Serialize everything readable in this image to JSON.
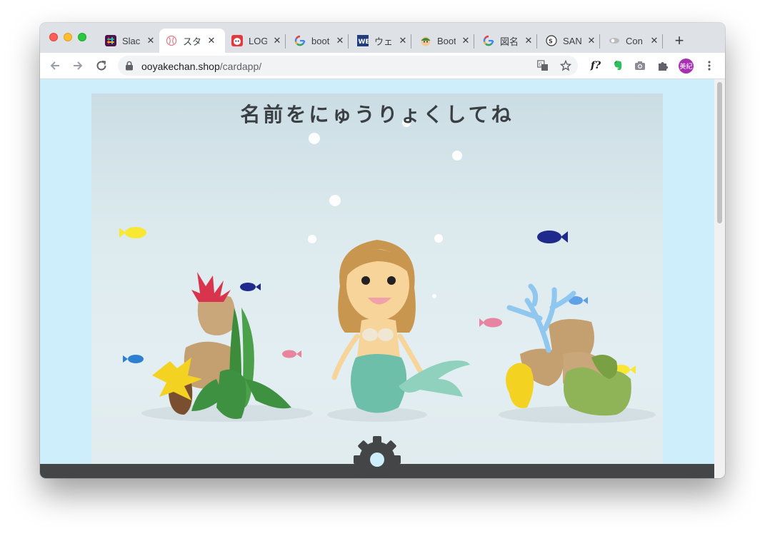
{
  "browser": {
    "tabs": [
      {
        "label": "Slac",
        "icon": "slack-icon",
        "active": false
      },
      {
        "label": "スタ",
        "icon": "baseball-icon",
        "active": true
      },
      {
        "label": "LOG",
        "icon": "log-face-icon",
        "active": false
      },
      {
        "label": "boot",
        "icon": "google-icon",
        "active": false
      },
      {
        "label": "ウェ",
        "icon": "wb-icon",
        "active": false
      },
      {
        "label": "Boot",
        "icon": "bootstrap-face-icon",
        "active": false
      },
      {
        "label": "図名",
        "icon": "google-icon",
        "active": false
      },
      {
        "label": "SAN",
        "icon": "s-circle-icon",
        "active": false
      },
      {
        "label": "Con",
        "icon": "eye-icon",
        "active": false
      }
    ],
    "url_host": "ooyakechan.shop",
    "url_path": "/cardapp/",
    "avatar_text": "美紀",
    "ext_fx_label": "f?"
  },
  "page": {
    "title": "名前をにゅうりょくしてね",
    "background_color": "#cfeefb",
    "footer_color": "#444547"
  },
  "icons": [
    "back-arrow-icon",
    "forward-arrow-icon",
    "reload-icon",
    "lock-icon",
    "translate-icon",
    "star-icon",
    "evernote-icon",
    "camera-icon",
    "puzzle-icon",
    "kebab-menu-icon",
    "settings-gear-icon"
  ]
}
